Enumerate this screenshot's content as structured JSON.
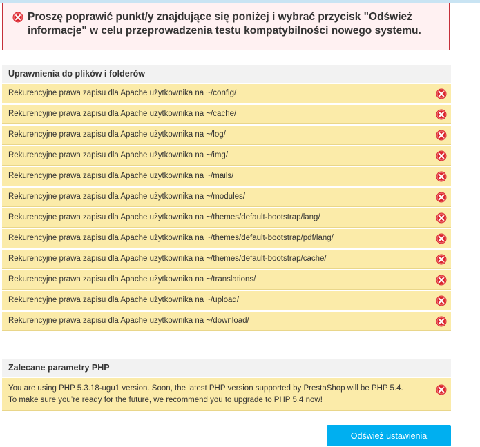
{
  "alert": {
    "message": "Proszę poprawić punkt/y znajdujące się poniżej i wybrać przycisk \"Odśwież informacje\" w celu przeprowadzenia testu kompatybilności nowego systemu.",
    "icon": "error-icon"
  },
  "permissions": {
    "title": "Uprawnienia do plików i folderów",
    "items": [
      {
        "label": "Rekurencyjne prawa zapisu dla Apache użytkownika na ~/config/"
      },
      {
        "label": "Rekurencyjne prawa zapisu dla Apache użytkownika na ~/cache/"
      },
      {
        "label": "Rekurencyjne prawa zapisu dla Apache użytkownika na ~/log/"
      },
      {
        "label": "Rekurencyjne prawa zapisu dla Apache użytkownika na ~/img/"
      },
      {
        "label": "Rekurencyjne prawa zapisu dla Apache użytkownika na ~/mails/"
      },
      {
        "label": "Rekurencyjne prawa zapisu dla Apache użytkownika na ~/modules/"
      },
      {
        "label": "Rekurencyjne prawa zapisu dla Apache użytkownika na ~/themes/default-bootstrap/lang/"
      },
      {
        "label": "Rekurencyjne prawa zapisu dla Apache użytkownika na ~/themes/default-bootstrap/pdf/lang/"
      },
      {
        "label": "Rekurencyjne prawa zapisu dla Apache użytkownika na ~/themes/default-bootstrap/cache/"
      },
      {
        "label": "Rekurencyjne prawa zapisu dla Apache użytkownika na ~/translations/"
      },
      {
        "label": "Rekurencyjne prawa zapisu dla Apache użytkownika na ~/upload/"
      },
      {
        "label": "Rekurencyjne prawa zapisu dla Apache użytkownika na ~/download/"
      }
    ]
  },
  "php": {
    "title": "Zalecane parametry PHP",
    "line1": "You are using PHP 5.3.18-ugu1 version. Soon, the latest PHP version supported by PrestaShop will be PHP 5.4.",
    "line2": "To make sure you’re ready for the future, we recommend you to upgrade to PHP 5.4 now!"
  },
  "refresh_button": {
    "label": "Odśwież ustawienia"
  },
  "colors": {
    "error_red": "#d9262e",
    "warning_bg": "#fbeba9",
    "alert_bg": "#fff1f2",
    "button_blue": "#00aff0"
  }
}
